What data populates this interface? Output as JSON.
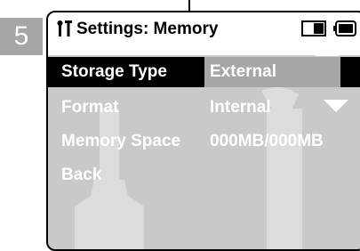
{
  "step": {
    "number": "5"
  },
  "screen": {
    "title": "Settings: Memory",
    "icons": {
      "title": "settings-tool-icon",
      "mode": "memory-card-in-icon",
      "battery": "battery-icon"
    }
  },
  "menu": {
    "items": [
      {
        "label": "Storage Type",
        "value": "External",
        "selected": true
      },
      {
        "label": "Format",
        "value": "Internal"
      },
      {
        "label": "Memory Space",
        "value": "000MB/000MB"
      },
      {
        "label": "Back",
        "value": ""
      }
    ]
  },
  "colors": {
    "badge": "#a6a6a6",
    "lcd_background": "#c9c9c9",
    "header": "#ffffff",
    "selected_row": "#000000",
    "selected_value": "#a6a6a6",
    "text": "#ffffff"
  }
}
